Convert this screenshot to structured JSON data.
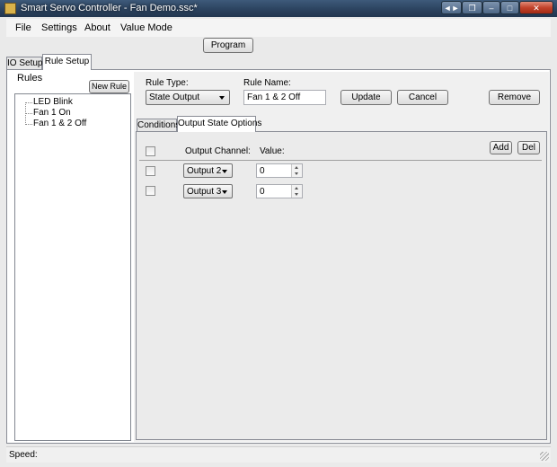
{
  "window": {
    "title": "Smart Servo Controller - Fan Demo.ssc*",
    "controls": [
      "◄►",
      "❐",
      "–",
      "□",
      "✕"
    ]
  },
  "menu": [
    "File",
    "Settings",
    "About",
    "Value Mode"
  ],
  "toolbar": {
    "program_label": "Program"
  },
  "main_tabs": [
    "IO Setup",
    "Rule Setup"
  ],
  "rules": {
    "heading": "Rules",
    "new_rule_label": "New Rule",
    "items": [
      "LED Blink",
      "Fan 1 On",
      "Fan 1 & 2 Off"
    ]
  },
  "form": {
    "rule_type_label": "Rule Type:",
    "rule_type_value": "State Output",
    "rule_name_label": "Rule Name:",
    "rule_name_value": "Fan 1 & 2 Off",
    "update_label": "Update",
    "cancel_label": "Cancel",
    "remove_label": "Remove"
  },
  "sub_tabs": [
    "Conditions",
    "Output State Options"
  ],
  "outputs": {
    "channel_header": "Output Channel:",
    "value_header": "Value:",
    "add_label": "Add",
    "del_label": "Del",
    "rows": [
      {
        "channel": "Output 2",
        "value": "0"
      },
      {
        "channel": "Output 3",
        "value": "0"
      }
    ]
  },
  "status": {
    "speed_label": "Speed:"
  }
}
